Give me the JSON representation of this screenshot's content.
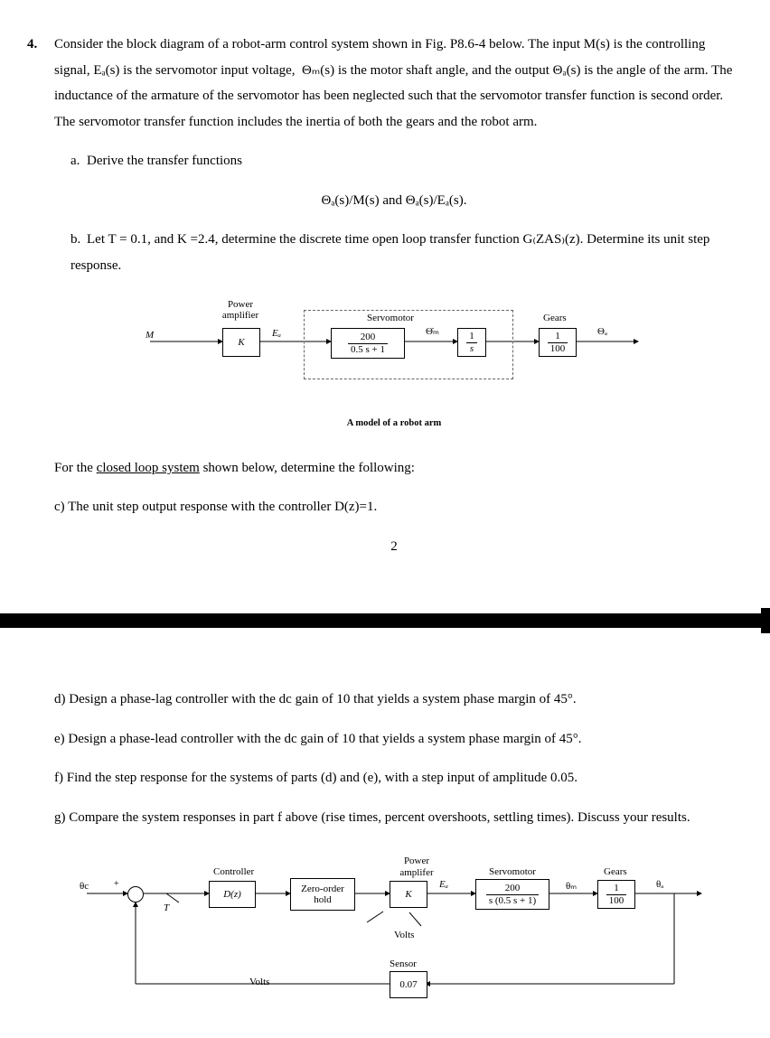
{
  "q": {
    "num": "4.",
    "intro": "Consider the block diagram of a robot-arm control system shown in Fig. P8.6-4 below. The input M(s) is the controlling signal, Eₐ(s) is the servomotor input voltage,  Θₘ(s) is the motor shaft angle, and the output Θₐ(s) is the angle of the arm. The inductance of the armature of the servomotor has been neglected such that the servomotor transfer function is second order. The servomotor transfer function includes the inertia of both the gears and the robot arm.",
    "a": {
      "letter": "a.",
      "text": "Derive the transfer functions"
    },
    "tf": "Θₐ(s)/M(s) and Θₐ(s)/Eₐ(s).",
    "b": {
      "letter": "b.",
      "text": "Let T = 0.1, and K =2.4, determine the discrete time open loop transfer function G₍ZAS₎(z). Determine its unit step response."
    },
    "mid1": "For the ",
    "mid_u": "closed loop system",
    "mid2": " shown below, determine the following:",
    "c": "c) The unit step output response with the controller D(z)=1.",
    "page": "2",
    "d": "d) Design a phase-lag controller with the dc gain of 10 that yields a system phase margin of 45°.",
    "e": "e) Design a phase-lead controller with the dc gain of 10 that yields a system phase margin of 45°.",
    "f": "f) Find the step response for the systems of parts (d) and (e), with a step input of amplitude 0.05.",
    "g": "g) Compare the system responses in part f above (rise times, percent overshoots, settling times). Discuss your results."
  },
  "d1": {
    "powamp": "Power\namplifier",
    "servo": "Servomotor",
    "gears": "Gears",
    "M": "M",
    "K": "K",
    "Ea": "Eₐ",
    "tf_n": "200",
    "tf_d": "0.5 s + 1",
    "thm": "Θ̇ₘ",
    "int_n": "1",
    "int_d": "s",
    "g_n": "1",
    "g_d": "100",
    "tha": "Θₐ",
    "caption": "A model of a robot arm"
  },
  "d2": {
    "ctrl": "Controller",
    "powamp": "Power\namplifer",
    "servo": "Servomotor",
    "gears": "Gears",
    "thc": "θc",
    "plus": "+",
    "T": "T",
    "Dz": "D(z)",
    "zoh": "Zero-order\nhold",
    "K": "K",
    "Ea": "Eₐ",
    "tf_n": "200",
    "tf_d": "s (0.5 s + 1)",
    "thm": "θₘ",
    "g_n": "1",
    "g_d": "100",
    "tha": "θₐ",
    "volts": "Volts",
    "sensor": "Sensor",
    "sval": "0.07"
  }
}
